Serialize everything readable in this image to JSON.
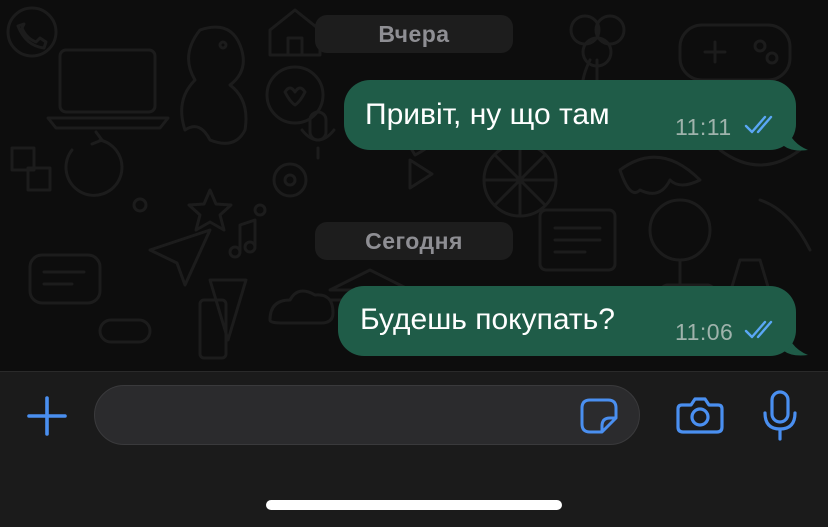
{
  "chat": {
    "date_yesterday": "Вчера",
    "date_today": "Сегодня",
    "messages": [
      {
        "text": "Привіт, ну що там",
        "time": "11:11",
        "status": "read"
      },
      {
        "text": "Будешь покупать?",
        "time": "11:06",
        "status": "read"
      }
    ]
  },
  "input": {
    "value": "",
    "placeholder": ""
  },
  "icons": {
    "attach": "plus-icon",
    "sticker": "sticker-icon",
    "camera": "camera-icon",
    "mic": "microphone-icon",
    "ticks": "double-check-icon"
  },
  "colors": {
    "accent": "#4a8ff0",
    "bubble_outgoing": "#1f5c48",
    "background": "#0d0d0d",
    "date_chip": "#1d1d1d",
    "read_ticks": "#5aa7f5"
  }
}
